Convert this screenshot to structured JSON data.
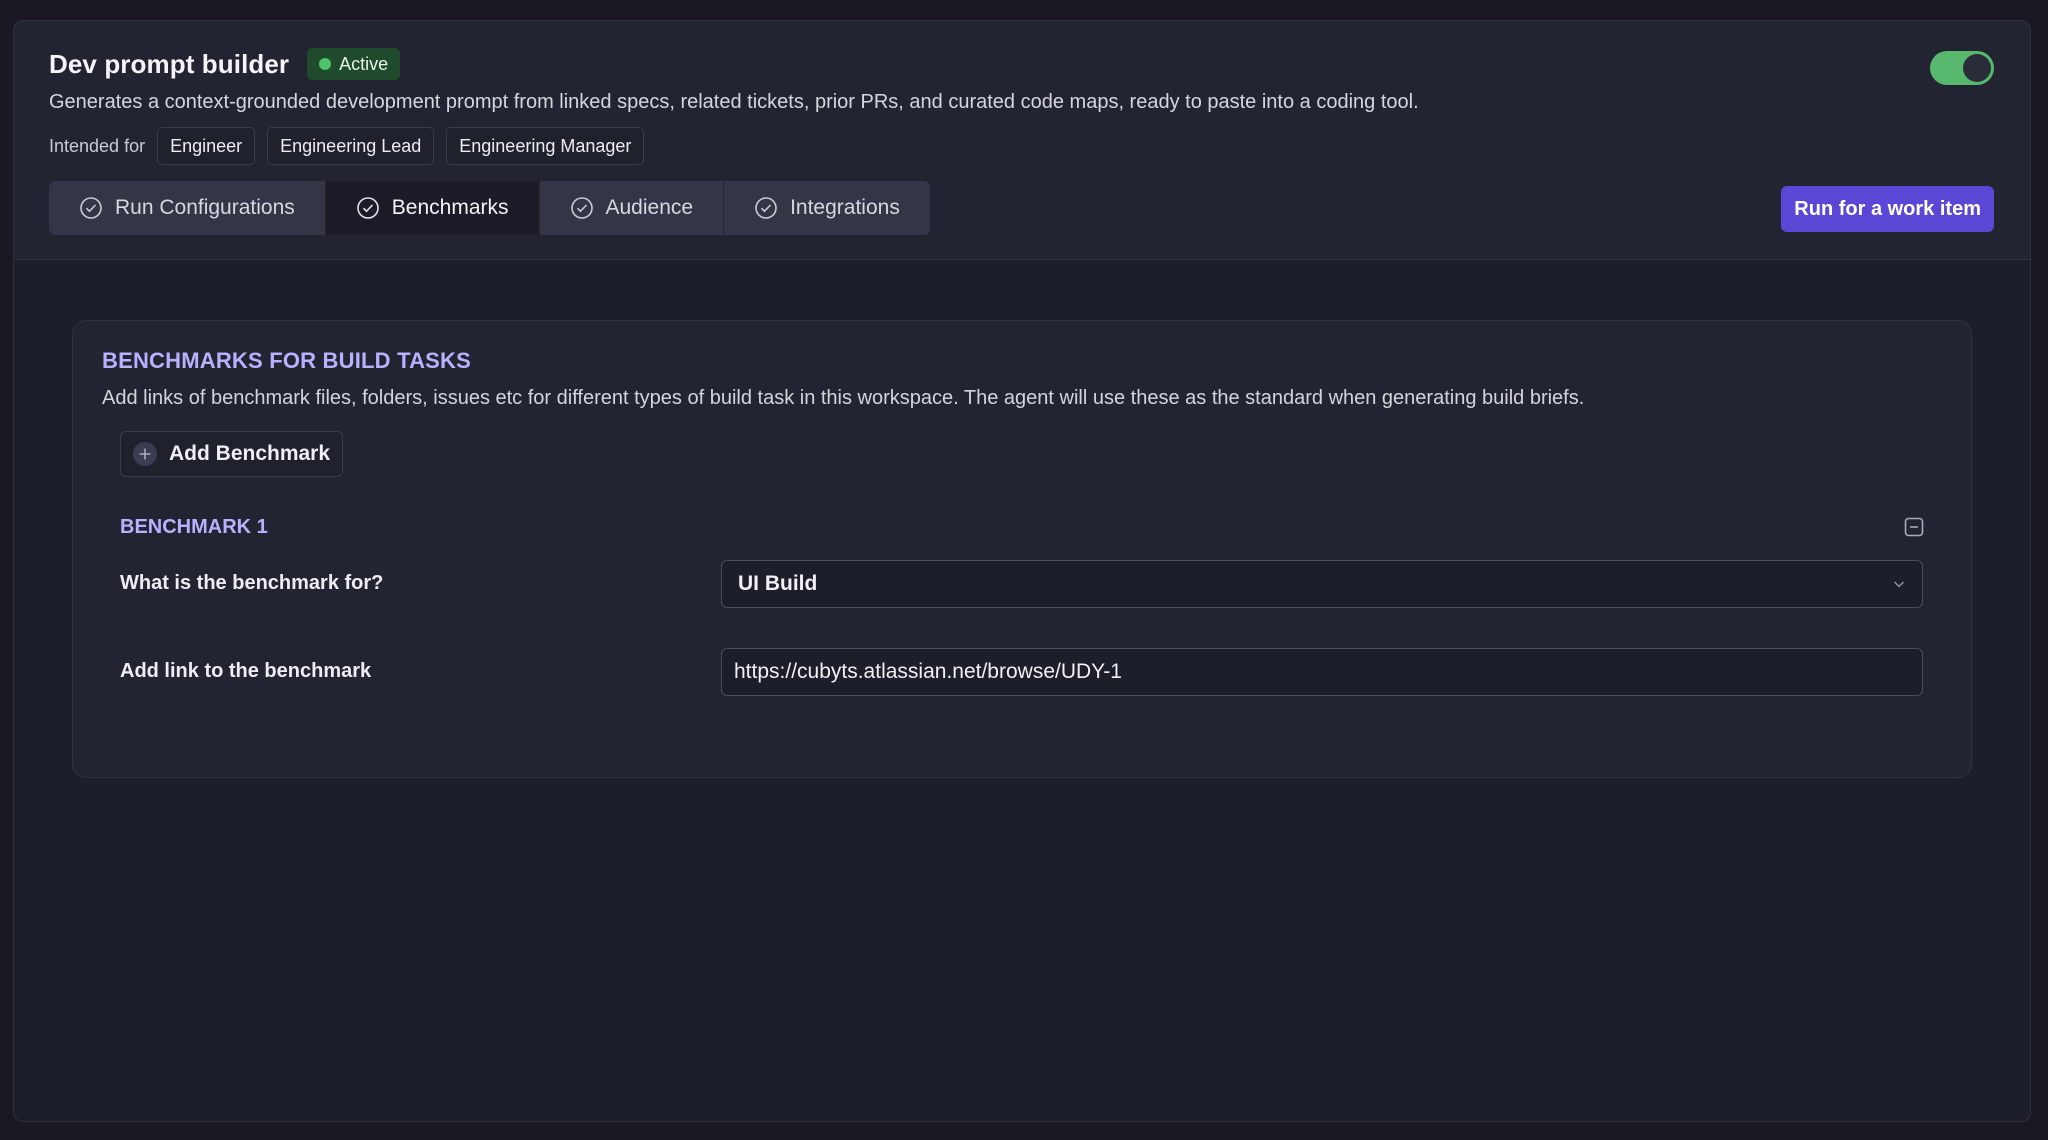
{
  "header": {
    "title": "Dev prompt builder",
    "status": "Active",
    "description": "Generates a context-grounded development prompt from linked specs, related tickets, prior PRs, and curated code maps, ready to paste into a coding tool.",
    "intended_label": "Intended for",
    "audiences": [
      "Engineer",
      "Engineering Lead",
      "Engineering Manager"
    ],
    "toggle_on": true
  },
  "tabs": [
    {
      "label": "Run Configurations",
      "active": false
    },
    {
      "label": "Benchmarks",
      "active": true
    },
    {
      "label": "Audience",
      "active": false
    },
    {
      "label": "Integrations",
      "active": false
    }
  ],
  "run_button": "Run for a work item",
  "benchmarks": {
    "title": "BENCHMARKS FOR BUILD TASKS",
    "description": "Add links of benchmark files, folders, issues etc for different types of build task in this workspace. The agent will use these as the standard when generating build briefs.",
    "add_label": "Add Benchmark",
    "items": [
      {
        "title": "BENCHMARK 1",
        "purpose_label": "What is the benchmark for?",
        "purpose_value": "UI Build",
        "link_label": "Add link to the benchmark",
        "link_value": "https://cubyts.atlassian.net/browse/UDY-1"
      }
    ]
  },
  "colors": {
    "accent": "#5a47d6",
    "section_title": "#b9b1ff",
    "status_green": "#4fc46a",
    "toggle_green": "#58b86e"
  }
}
